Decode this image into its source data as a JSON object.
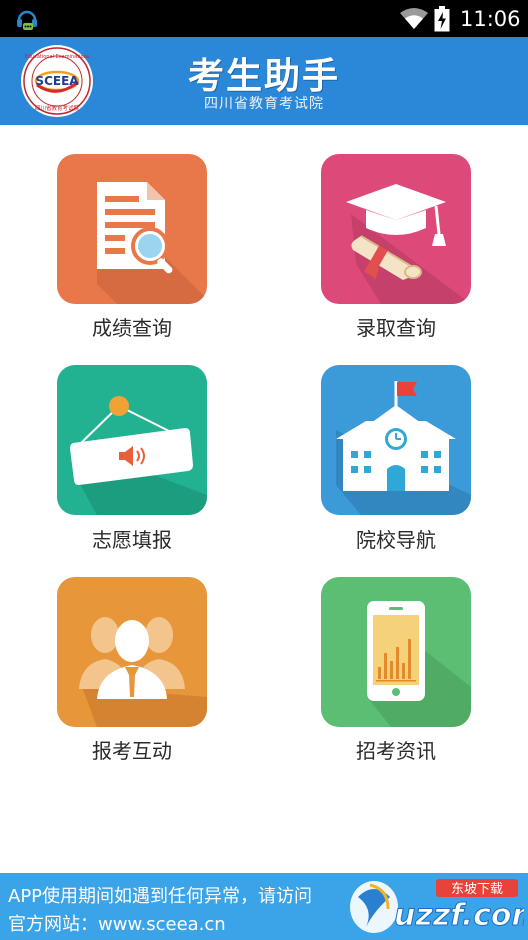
{
  "status_bar": {
    "time": "11:06"
  },
  "header": {
    "title": "考生助手",
    "subtitle": "四川省教育考试院",
    "logo_text": "SCEEA",
    "logo_ring_text": "Sichuan Educational Examinations Authority"
  },
  "menu": [
    {
      "label": "成绩查询",
      "color": "#e8784a",
      "icon": "score-document-icon"
    },
    {
      "label": "录取查询",
      "color": "#dd4a7a",
      "icon": "graduation-cap-icon"
    },
    {
      "label": "志愿填报",
      "color": "#22b191",
      "icon": "hanging-sign-icon"
    },
    {
      "label": "院校导航",
      "color": "#3b9ad8",
      "icon": "school-building-icon"
    },
    {
      "label": "报考互动",
      "color": "#e8963a",
      "icon": "people-icon"
    },
    {
      "label": "招考资讯",
      "color": "#5cbe72",
      "icon": "phone-chart-icon"
    }
  ],
  "footer": {
    "line1": "APP使用期间如遇到任何异常，请访问",
    "line2": "官方网站：www.sceea.cn",
    "watermark": "uzzf.com",
    "watermark_tag": "东坡下载"
  },
  "colors": {
    "header": "#2b87d8",
    "footer": "#3ba3e8",
    "status_bar": "#000000"
  }
}
